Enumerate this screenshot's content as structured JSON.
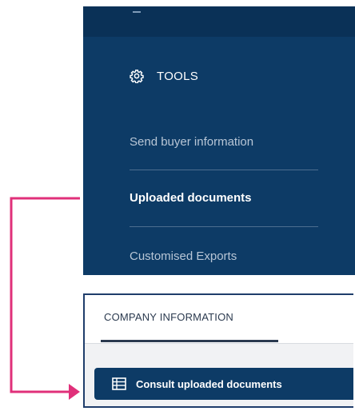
{
  "sidebar": {
    "section_title": "TOOLS",
    "section_icon": "gear-icon",
    "items": [
      {
        "label": "Send buyer information",
        "active": false
      },
      {
        "label": "Uploaded documents",
        "active": true
      },
      {
        "label": "Customised Exports",
        "active": false
      }
    ]
  },
  "company_panel": {
    "tab_label": "COMPANY INFORMATION",
    "button_label": "Consult uploaded documents",
    "button_icon": "table-icon"
  },
  "colors": {
    "sidebar_bg": "#0d3b66",
    "connector": "#e0307a",
    "button_bg": "#0d3b66"
  }
}
